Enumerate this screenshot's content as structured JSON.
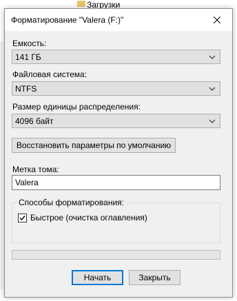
{
  "background": {
    "file_label": "Загрузки"
  },
  "dialog": {
    "title": "Форматирование \"Valera (F:)\"",
    "capacity": {
      "label": "Емкость:",
      "value": "141 ГБ"
    },
    "filesystem": {
      "label": "Файловая система:",
      "value": "NTFS"
    },
    "allocation": {
      "label": "Размер единицы распределения:",
      "value": "4096 байт"
    },
    "restore_defaults_label": "Восстановить параметры по умолчанию",
    "volume_label": {
      "label": "Метка тома:",
      "value": "Valera"
    },
    "format_options": {
      "label": "Способы форматирования:",
      "quick": {
        "label": "Быстрое (очистка оглавления)",
        "checked": true
      }
    },
    "progress": 0,
    "start_label": "Начать",
    "close_label": "Закрыть"
  },
  "colors": {
    "accent": "#0078d7",
    "dialog_bg": "#f0f0f0",
    "button_bg": "#e1e1e1",
    "folder": "#e9c46a"
  }
}
